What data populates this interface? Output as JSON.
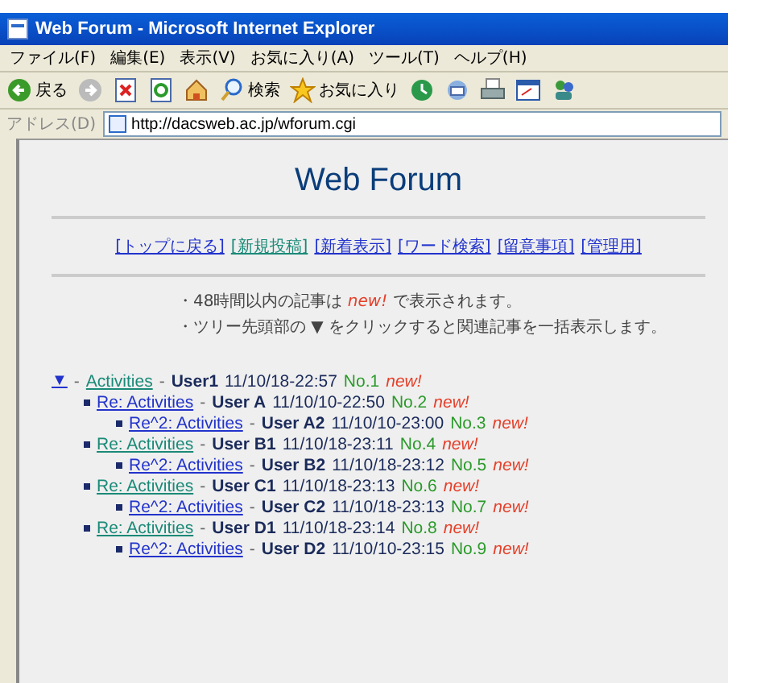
{
  "window": {
    "title": "Web Forum - Microsoft Internet Explorer"
  },
  "menu": [
    "ファイル(F)",
    "編集(E)",
    "表示(V)",
    "お気に入り(A)",
    "ツール(T)",
    "ヘルプ(H)"
  ],
  "toolbar": [
    {
      "kind": "back",
      "label": "戻る"
    },
    {
      "kind": "forward"
    },
    {
      "kind": "stop"
    },
    {
      "kind": "refresh"
    },
    {
      "kind": "home"
    },
    {
      "kind": "search",
      "label": "検索"
    },
    {
      "kind": "favorites",
      "label": "お気に入り"
    },
    {
      "kind": "history"
    },
    {
      "kind": "mail"
    },
    {
      "kind": "print"
    },
    {
      "kind": "edit"
    },
    {
      "kind": "messenger"
    }
  ],
  "address": {
    "label": "アドレス(D)",
    "url": "http://dacsweb.ac.jp/wforum.cgi"
  },
  "page": {
    "heading": "Web Forum",
    "nav": [
      {
        "label": "[トップに戻る]",
        "visited": false
      },
      {
        "label": "[新規投稿]",
        "visited": true
      },
      {
        "label": "[新着表示]",
        "visited": false
      },
      {
        "label": "[ワード検索]",
        "visited": false
      },
      {
        "label": "[留意事項]",
        "visited": false
      },
      {
        "label": "[管理用]",
        "visited": false
      }
    ],
    "notes": [
      {
        "before": "・48時間以内の記事は ",
        "highlight": "new!",
        "after": " で表示されます。"
      },
      {
        "before": "・ツリー先頭部の ▼ をクリックすると関連記事を一括表示します。"
      }
    ],
    "tree": [
      {
        "marker": "▼",
        "title": "Activities",
        "visited": true,
        "separator": "-",
        "user": "User1",
        "date": "11/10/18-22:57",
        "no": "No.1",
        "badge": "new!",
        "children": [
          {
            "title": "Re: Activities",
            "visited": false,
            "separator": "-",
            "user": "User A",
            "date": "11/10/10-22:50",
            "no": "No.2",
            "badge": "new!",
            "children": [
              {
                "title": "Re^2: Activities",
                "visited": false,
                "separator": "-",
                "user": "User A2",
                "date": "11/10/10-23:00",
                "no": "No.3",
                "badge": "new!"
              }
            ]
          },
          {
            "title": "Re: Activities",
            "visited": true,
            "separator": "-",
            "user": "User B1",
            "date": "11/10/18-23:11",
            "no": "No.4",
            "badge": "new!",
            "children": [
              {
                "title": "Re^2: Activities",
                "visited": false,
                "separator": "-",
                "user": "User B2",
                "date": "11/10/18-23:12",
                "no": "No.5",
                "badge": "new!"
              }
            ]
          },
          {
            "title": "Re: Activities",
            "visited": true,
            "separator": "-",
            "user": "User C1",
            "date": "11/10/18-23:13",
            "no": "No.6",
            "badge": "new!",
            "children": [
              {
                "title": "Re^2: Activities",
                "visited": false,
                "separator": "-",
                "user": "User C2",
                "date": "11/10/18-23:13",
                "no": "No.7",
                "badge": "new!"
              }
            ]
          },
          {
            "title": "Re: Activities",
            "visited": true,
            "separator": "-",
            "user": "User D1",
            "date": "11/10/18-23:14",
            "no": "No.8",
            "badge": "new!",
            "children": [
              {
                "title": "Re^2: Activities",
                "visited": false,
                "separator": "-",
                "user": "User D2",
                "date": "11/10/10-23:15",
                "no": "No.9",
                "badge": "new!"
              }
            ]
          }
        ]
      }
    ]
  }
}
